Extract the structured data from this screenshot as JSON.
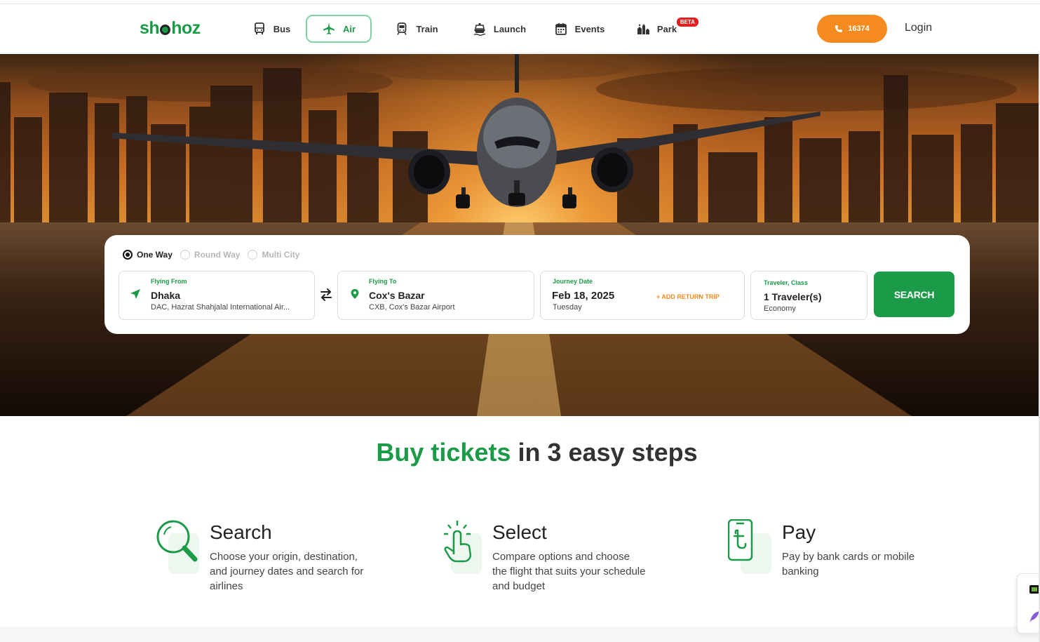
{
  "brand": {
    "logo_text_1": "sh",
    "logo_text_2": "hoz",
    "accent": "#1b9a47",
    "orange": "#f58a1f"
  },
  "nav": {
    "items": [
      {
        "label": "Bus",
        "icon": "bus-icon"
      },
      {
        "label": "Air",
        "icon": "plane-icon",
        "active": true
      },
      {
        "label": "Train",
        "icon": "train-icon"
      },
      {
        "label": "Launch",
        "icon": "ship-icon"
      },
      {
        "label": "Events",
        "icon": "calendar-icon"
      },
      {
        "label": "Park",
        "icon": "park-icon",
        "badge": "BETA"
      }
    ],
    "phone": "16374",
    "login": "Login"
  },
  "search": {
    "trip_types": [
      "One Way",
      "Round Way",
      "Multi City"
    ],
    "selected_trip": "One Way",
    "from": {
      "label": "Flying From",
      "value": "Dhaka",
      "sub": "DAC, Hazrat Shahjalal International Air..."
    },
    "to": {
      "label": "Flying To",
      "value": "Cox's Bazar",
      "sub": "CXB, Cox's Bazar Airport"
    },
    "date": {
      "label": "Journey Date",
      "value": "Feb 18, 2025",
      "sub": "Tuesday",
      "add_return": "+ ADD RETURN TRIP"
    },
    "traveler": {
      "label": "Traveler, Class",
      "value": "1 Traveler(s)",
      "sub": "Economy"
    },
    "button": "SEARCH"
  },
  "steps": {
    "title_highlight": "Buy tickets",
    "title_rest": " in 3 easy steps",
    "items": [
      {
        "title": "Search",
        "desc": "Choose your origin, destination, and journey dates and search for airlines",
        "icon": "magnifier-icon"
      },
      {
        "title": "Select",
        "desc": "Compare options and choose the flight that suits your schedule and budget",
        "icon": "tap-hand-icon"
      },
      {
        "title": "Pay",
        "desc": "Pay by bank cards or mobile banking",
        "icon": "mobile-taka-icon"
      }
    ]
  }
}
